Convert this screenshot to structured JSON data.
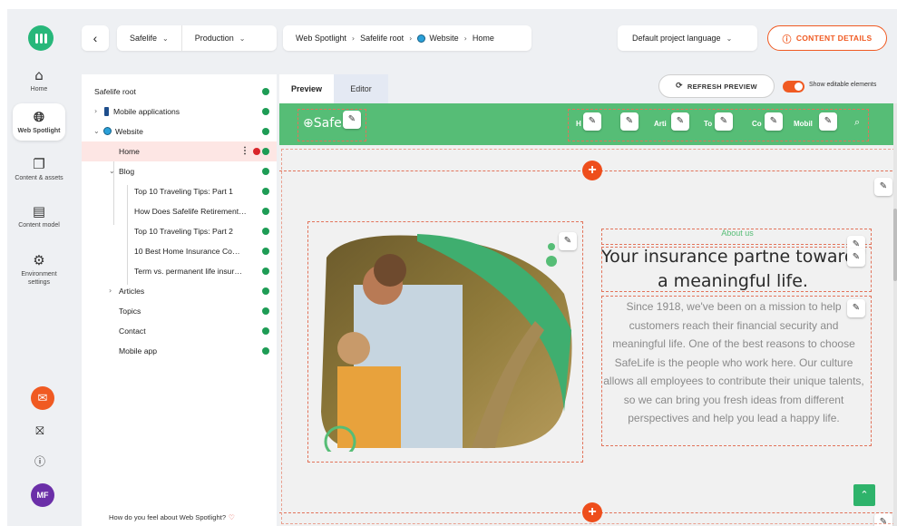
{
  "rail": {
    "items": [
      {
        "label": "Home",
        "icon": "home-icon"
      },
      {
        "label": "Web Spotlight",
        "icon": "globe-icon"
      },
      {
        "label": "Content & assets",
        "icon": "content-icon"
      },
      {
        "label": "Content model",
        "icon": "model-icon"
      },
      {
        "label": "Environment settings",
        "icon": "settings-icon"
      }
    ],
    "avatar_initials": "MF"
  },
  "topbar": {
    "back_glyph": "‹",
    "project": "Safelife",
    "environment": "Production",
    "breadcrumb": [
      "Web Spotlight",
      "Safelife root",
      "Website",
      "Home"
    ],
    "language": "Default project language",
    "details_button": "CONTENT DETAILS"
  },
  "tree": {
    "root": "Safelife root",
    "items": [
      {
        "label": "Mobile applications"
      },
      {
        "label": "Website"
      },
      {
        "label": "Home",
        "selected": true
      },
      {
        "label": "Blog"
      },
      {
        "label": "Top 10 Traveling Tips: Part 1"
      },
      {
        "label": "How Does Safelife Retirement…"
      },
      {
        "label": "Top 10 Traveling Tips: Part 2"
      },
      {
        "label": "10 Best Home Insurance Co…"
      },
      {
        "label": "Term vs. permanent life insur…"
      },
      {
        "label": "Articles"
      },
      {
        "label": "Topics"
      },
      {
        "label": "Contact"
      },
      {
        "label": "Mobile app"
      }
    ],
    "feedback": "How do you feel about Web Spotlight?"
  },
  "tabs": {
    "preview": "Preview",
    "editor": "Editor"
  },
  "toolbar": {
    "refresh": "REFRESH PREVIEW",
    "show_editable": "Show editable elements",
    "show_editable_on": true
  },
  "site": {
    "brand": "Safe",
    "nav": [
      "H",
      "",
      "Arti",
      "To",
      "Co",
      "Mobil"
    ],
    "about": "About us",
    "headline": "Your insurance partne towards a meaningful life.",
    "body": "Since 1918, we've been on a mission to help customers reach their financial security and meaningful life. One of the best reasons to choose SafeLife is the people who work here. Our culture allows all employees to contribute their unique talents, so we can bring you fresh ideas from different perspectives and help you lead a happy life."
  },
  "colors": {
    "accent": "#f05a22",
    "site_green": "#56bd76",
    "status_green": "#1e9c55",
    "selected_bg": "#fde6e4"
  }
}
